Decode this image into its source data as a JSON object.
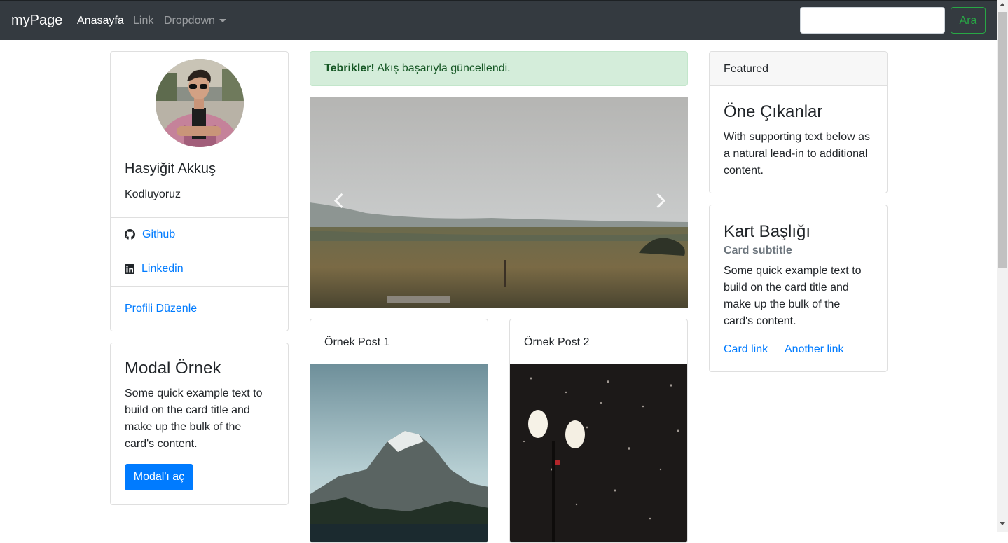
{
  "navbar": {
    "brand": "myPage",
    "links": [
      "Anasayfa",
      "Link",
      "Dropdown"
    ],
    "search_placeholder": "",
    "search_button": "Ara",
    "colors": {
      "background": "#343a40",
      "search_button": "#28a745"
    }
  },
  "profile": {
    "name": "Hasyiğit Akkuş",
    "tagline": "Kodluyoruz",
    "links": [
      {
        "label": "Github",
        "icon": "github-icon"
      },
      {
        "label": "Linkedin",
        "icon": "linkedin-icon"
      }
    ],
    "edit_link": "Profili Düzenle"
  },
  "modal_card": {
    "title": "Modal Örnek",
    "text": "Some quick example text to build on the card title and make up the bulk of the card's content.",
    "button": "Modal'ı aç"
  },
  "alert": {
    "strong": "Tebrikler!",
    "message": " Akış başarıyla güncellendi."
  },
  "carousel": {
    "prev_icon": "chevron-left-icon",
    "next_icon": "chevron-right-icon"
  },
  "posts": [
    {
      "title": "Örnek Post 1"
    },
    {
      "title": "Örnek Post 2"
    }
  ],
  "featured_card": {
    "header": "Featured",
    "title": "Öne Çıkanlar",
    "text": "With supporting text below as a natural lead-in to additional content."
  },
  "info_card": {
    "title": "Kart Başlığı",
    "subtitle": "Card subtitle",
    "text": "Some quick example text to build on the card title and make up the bulk of the card's content.",
    "link1": "Card link",
    "link2": "Another link"
  },
  "colors": {
    "primary": "#007bff",
    "alert_bg": "#d4edda",
    "alert_text": "#155724"
  }
}
